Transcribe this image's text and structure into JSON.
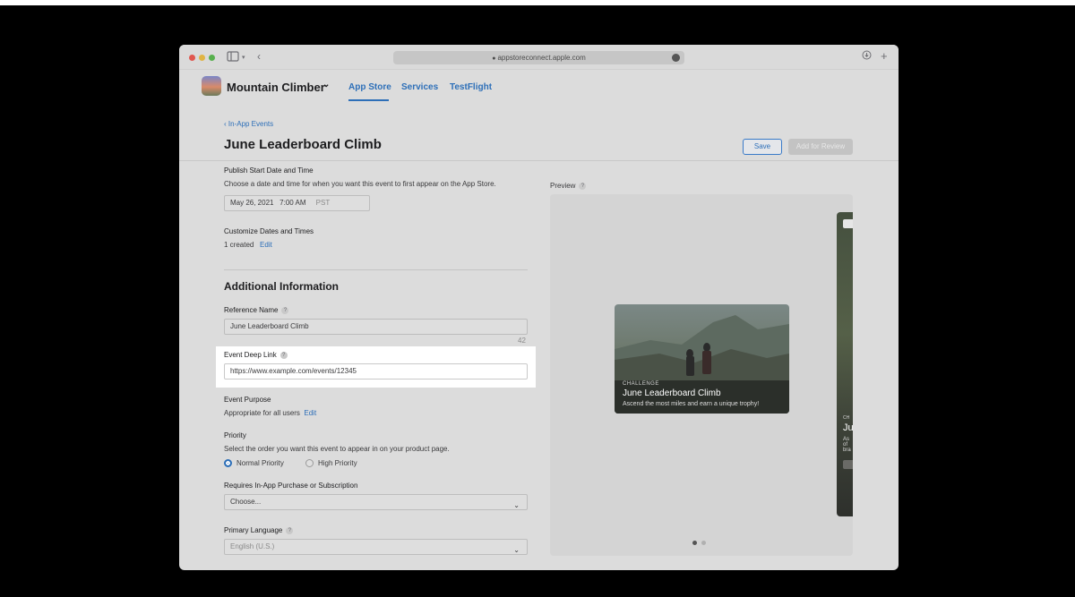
{
  "browser": {
    "url": "appstoreconnect.apple.com",
    "icons": {
      "sidebar": "sidebar-icon",
      "back": "chevron-left-icon",
      "download": "download-icon",
      "newtab": "plus-icon"
    }
  },
  "app": {
    "name": "Mountain Climber",
    "tabs": [
      {
        "label": "App Store",
        "active": true
      },
      {
        "label": "Services",
        "active": false
      },
      {
        "label": "TestFlight",
        "active": false
      }
    ]
  },
  "page": {
    "back_link": "In-App Events",
    "title": "June Leaderboard Climb",
    "save_label": "Save",
    "review_label": "Add for Review"
  },
  "form": {
    "publish": {
      "label": "Publish Start Date and Time",
      "description": "Choose a date and time for when you want this event to first appear on the App Store.",
      "date": "May 26, 2021",
      "time": "7:00 AM",
      "tz": "PST"
    },
    "customize": {
      "label": "Customize Dates and Times",
      "value": "1 created",
      "edit": "Edit"
    },
    "section_title": "Additional Information",
    "reference_name": {
      "label": "Reference Name",
      "value": "June Leaderboard Climb",
      "counter": "42"
    },
    "deep_link": {
      "label": "Event Deep Link",
      "value": "https://www.example.com/events/12345"
    },
    "purpose": {
      "label": "Event Purpose",
      "value": "Appropriate for all users",
      "edit": "Edit"
    },
    "priority": {
      "label": "Priority",
      "description": "Select the order you want this event to appear in on your product page.",
      "options": [
        {
          "label": "Normal Priority",
          "selected": true
        },
        {
          "label": "High Priority",
          "selected": false
        }
      ]
    },
    "iap": {
      "label": "Requires In-App Purchase or Subscription",
      "value": "Choose..."
    },
    "language": {
      "label": "Primary Language",
      "value": "English (U.S.)"
    }
  },
  "preview": {
    "label": "Preview",
    "card": {
      "tag": "CHALLENGE",
      "title": "June Leaderboard Climb",
      "subtitle": "Ascend the most miles and earn a unique trophy!"
    },
    "card2": {
      "tag": "CH",
      "title": "Ju",
      "lines": [
        "As",
        "of",
        "bra"
      ]
    },
    "pages": 2,
    "current_page": 1
  },
  "colors": {
    "accent": "#2d6fb8",
    "highlight": "#ffffff",
    "background": "#000000"
  }
}
